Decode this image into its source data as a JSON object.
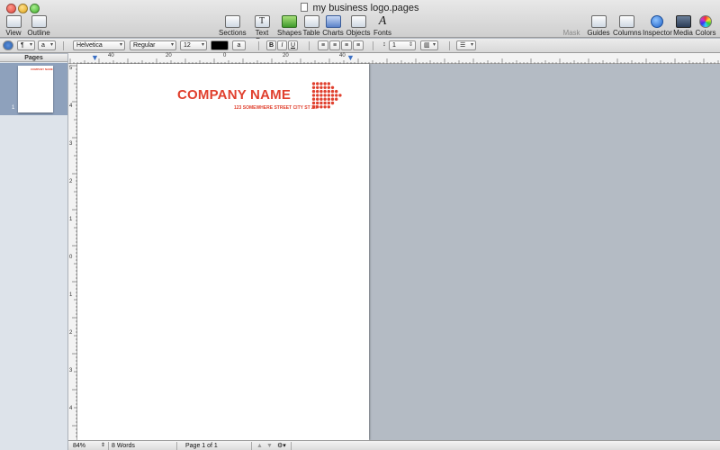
{
  "window": {
    "title": "my business logo.pages"
  },
  "toolbar": {
    "view": "View",
    "outline": "Outline",
    "sections": "Sections",
    "text_box": "Text Box",
    "shapes": "Shapes",
    "table": "Table",
    "charts": "Charts",
    "objects": "Objects",
    "fonts": "Fonts",
    "mask": "Mask",
    "guides": "Guides",
    "columns": "Columns",
    "inspector": "Inspector",
    "media": "Media",
    "colors": "Colors"
  },
  "format_bar": {
    "paragraph_style": "¶",
    "character_style": "a",
    "font_family": "Helvetica",
    "font_style": "Regular",
    "font_size": "12",
    "text_color": "#000000",
    "highlight_label": "a",
    "bold": "B",
    "italic": "I",
    "underline": "U",
    "line_spacing": "1"
  },
  "sidebar": {
    "header": "Pages",
    "pages": [
      {
        "number": "1"
      }
    ]
  },
  "rulers": {
    "horizontal_labels": [
      "40",
      "20",
      "0",
      "20",
      "40"
    ],
    "vertical_labels": [
      "5",
      "4",
      "3",
      "2",
      "1",
      "0",
      "1",
      "2",
      "3",
      "4"
    ]
  },
  "document": {
    "company_name": "COMPANY NAME",
    "company_address": "123 SOMEWHERE STREET CITY ST ZIP",
    "brand_color": "#e0402e"
  },
  "statusbar": {
    "zoom": "84%",
    "word_count": "8 Words",
    "page_indicator": "Page 1 of 1"
  }
}
